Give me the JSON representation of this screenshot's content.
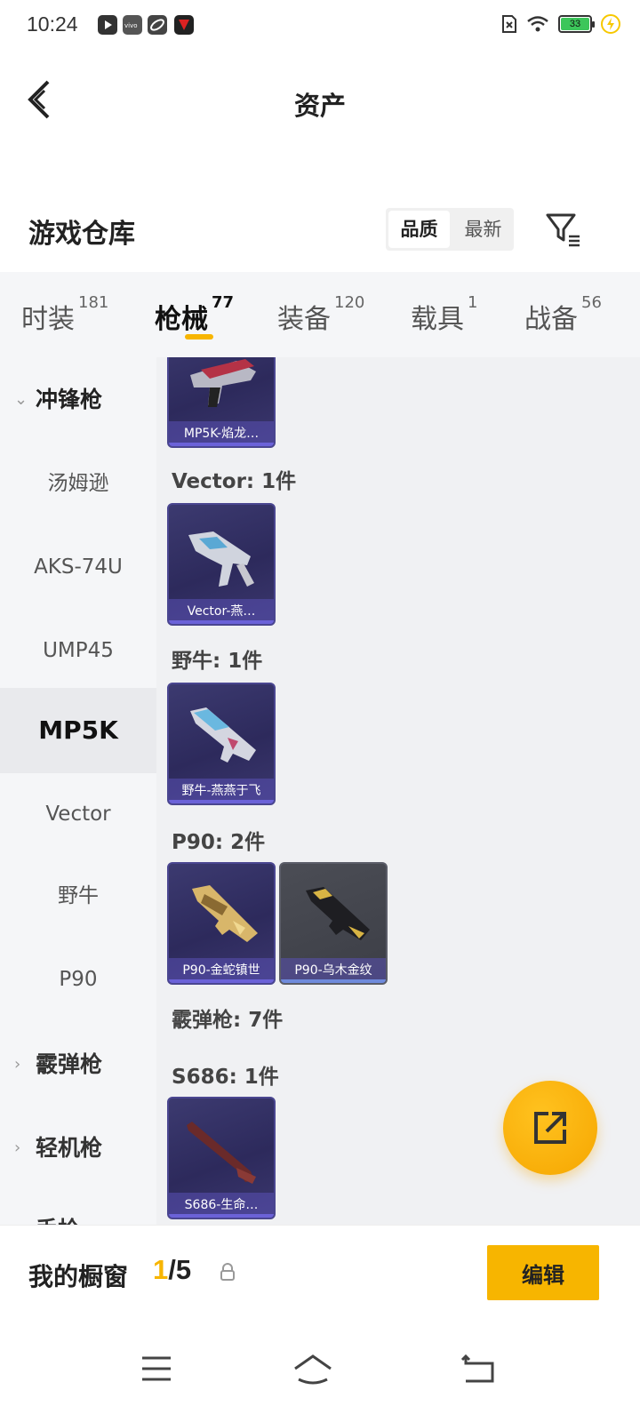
{
  "status_bar": {
    "time": "10:24",
    "battery_level": "33",
    "icons": [
      "video-app-icon",
      "vivo-icon",
      "link-app-icon",
      "game-app-icon",
      "sim-off-icon",
      "wifi-icon",
      "battery-icon",
      "charging-icon"
    ]
  },
  "header": {
    "title": "资产"
  },
  "warehouse": {
    "title": "游戏仓库",
    "sort_options": [
      "品质",
      "最新"
    ],
    "active_sort": "品质"
  },
  "tabs": [
    {
      "label": "时装",
      "count": "181"
    },
    {
      "label": "枪械",
      "count": "77",
      "active": true
    },
    {
      "label": "装备",
      "count": "120"
    },
    {
      "label": "载具",
      "count": "1"
    },
    {
      "label": "战备",
      "count": "56"
    }
  ],
  "sidebar": {
    "items": [
      {
        "label": "冲锋枪",
        "type": "category",
        "expanded": true
      },
      {
        "label": "汤姆逊"
      },
      {
        "label": "AKS-74U"
      },
      {
        "label": "UMP45"
      },
      {
        "label": "MP5K",
        "active": true
      },
      {
        "label": "Vector"
      },
      {
        "label": "野牛"
      },
      {
        "label": "P90"
      },
      {
        "label": "霰弹枪",
        "type": "category"
      },
      {
        "label": "轻机枪",
        "type": "category"
      },
      {
        "label": "手枪",
        "type": "category"
      }
    ]
  },
  "content": {
    "groups": [
      {
        "label": "",
        "cards": [
          {
            "name": "MP5K-焰龙…"
          }
        ]
      },
      {
        "label": "Vector: 1件",
        "cards": [
          {
            "name": "Vector-燕…"
          }
        ]
      },
      {
        "label": "野牛: 1件",
        "cards": [
          {
            "name": "野牛-燕燕于飞"
          }
        ]
      },
      {
        "label": "P90: 2件",
        "cards": [
          {
            "name": "P90-金蛇镇世"
          },
          {
            "name": "P90-乌木金纹"
          }
        ]
      },
      {
        "label": "霰弹枪: 7件",
        "cards": []
      },
      {
        "label": "S686: 1件",
        "cards": [
          {
            "name": "S686-生命…"
          }
        ]
      }
    ]
  },
  "bottom_bar": {
    "showcase_label": "我的橱窗",
    "current": "1",
    "total": "/5",
    "edit_label": "编辑"
  },
  "colors": {
    "accent": "#f7b500",
    "card_bg": "#2d2a5c",
    "sidebar_bg": "#f5f6f8"
  }
}
